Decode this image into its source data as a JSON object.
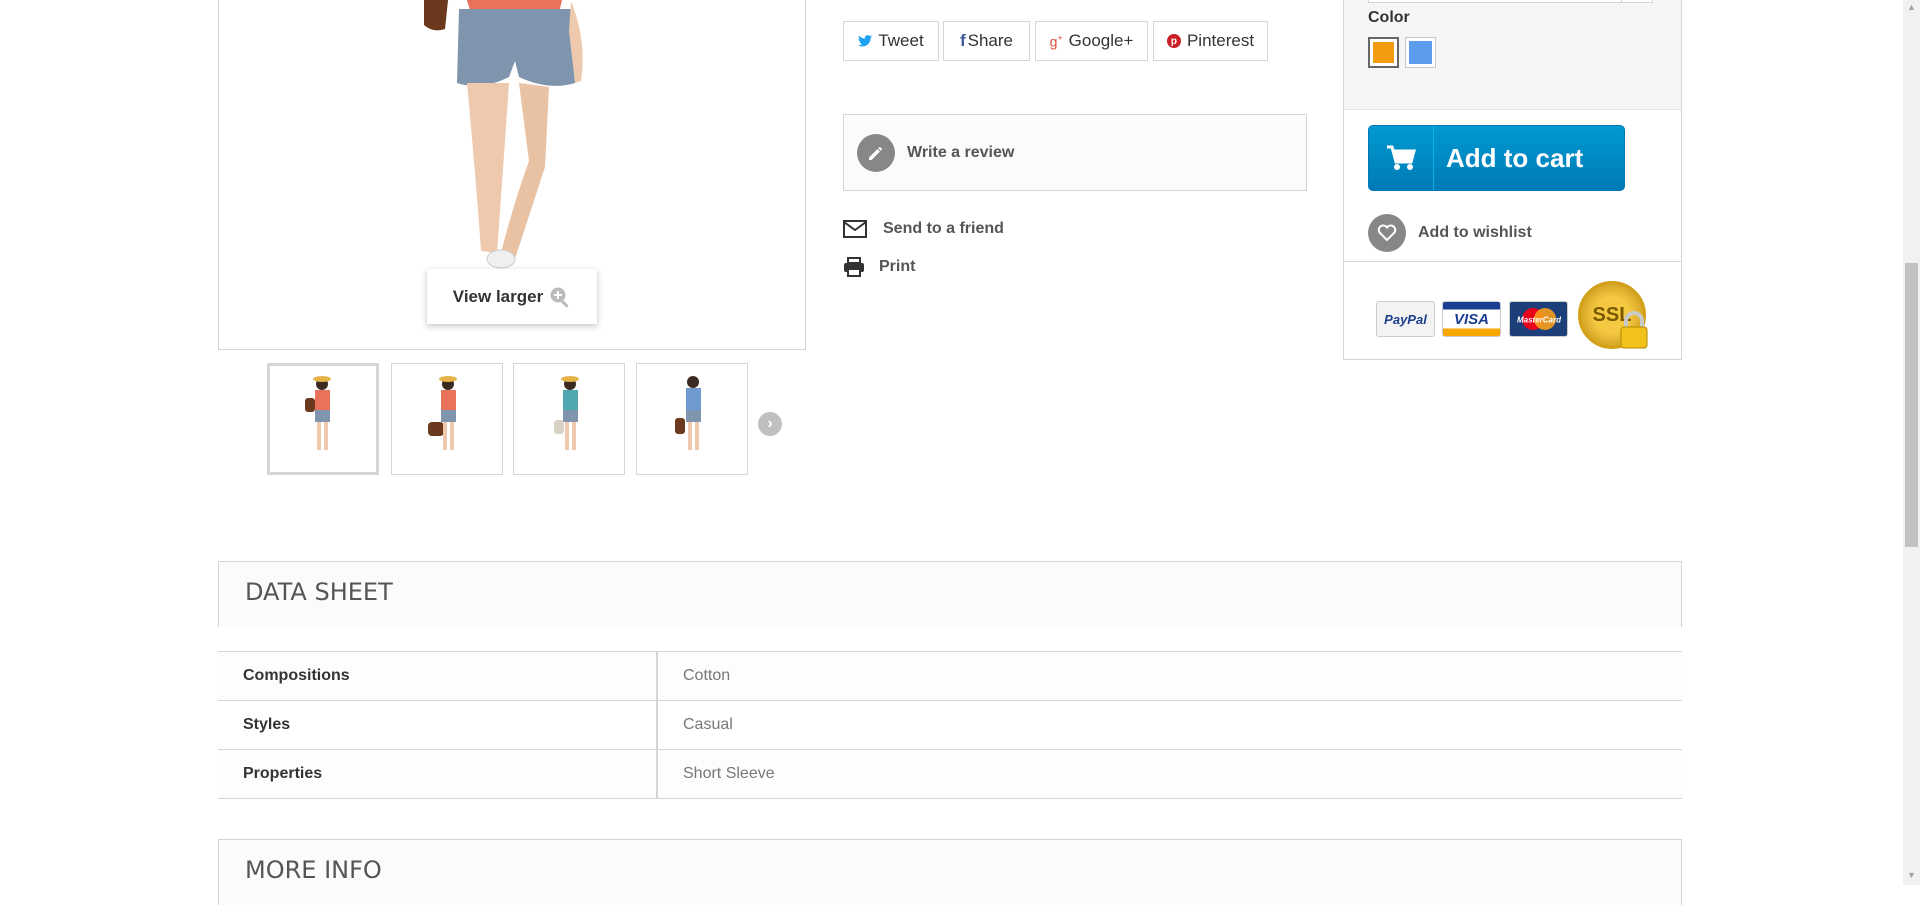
{
  "gallery": {
    "view_larger_label": "View larger",
    "thumbnails": [
      "thumb-1",
      "thumb-2",
      "thumb-3",
      "thumb-4"
    ]
  },
  "social": {
    "tweet": "Tweet",
    "share": "Share",
    "google": "Google+",
    "pinterest": "Pinterest"
  },
  "actions": {
    "write_review": "Write a review",
    "send_to_friend": "Send to a friend",
    "print": "Print"
  },
  "buy_box": {
    "color_label": "Color",
    "colors": [
      {
        "name": "Orange",
        "hex": "#f39c11",
        "selected": true
      },
      {
        "name": "Blue",
        "hex": "#5d9cec",
        "selected": false
      }
    ],
    "add_to_cart": "Add to cart",
    "add_to_wishlist": "Add to wishlist",
    "payments": [
      "PayPal",
      "VISA",
      "MasterCard",
      "SSL"
    ]
  },
  "data_sheet": {
    "title": "DATA SHEET",
    "rows": [
      {
        "key": "Compositions",
        "value": "Cotton"
      },
      {
        "key": "Styles",
        "value": "Casual"
      },
      {
        "key": "Properties",
        "value": "Short Sleeve"
      }
    ]
  },
  "more_info": {
    "title": "MORE INFO"
  },
  "colors": {
    "accent_blue": "#0088cc",
    "border": "#d6d4d4",
    "text_muted": "#777777"
  }
}
